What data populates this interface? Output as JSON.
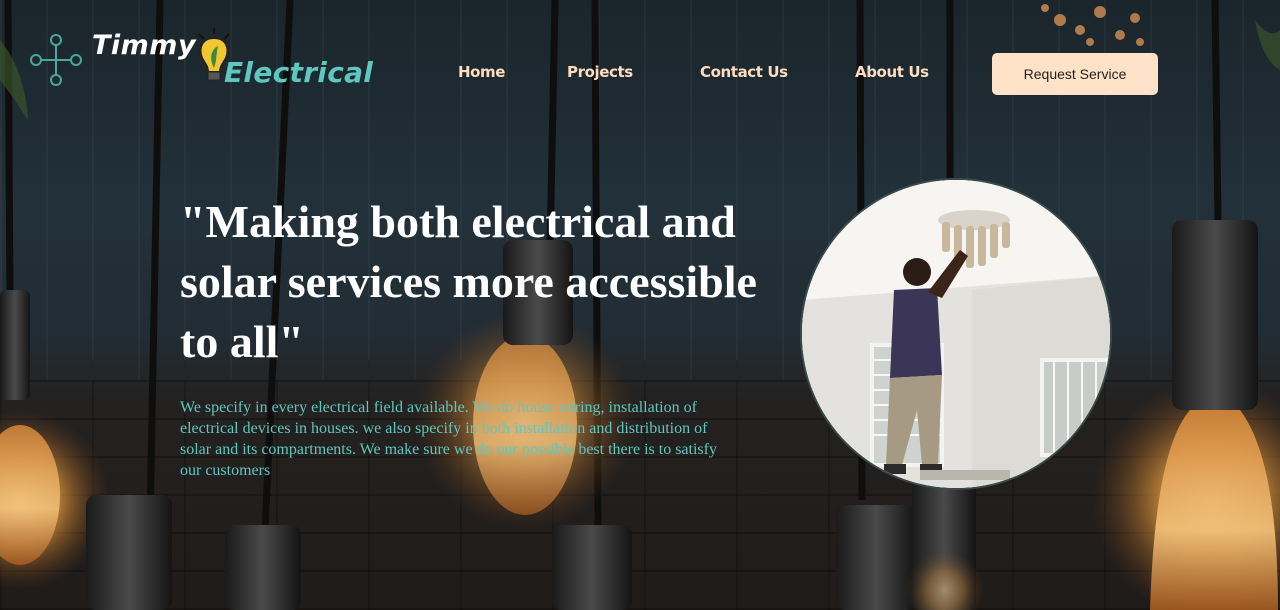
{
  "brand": {
    "name_part1": "Timmy",
    "name_part2": "Electrical",
    "icons": [
      "circuit-logo-icon",
      "lightbulb-icon"
    ]
  },
  "nav": {
    "items": [
      {
        "label": "Home"
      },
      {
        "label": "Projects"
      },
      {
        "label": "Contact Us"
      },
      {
        "label": "About Us"
      }
    ],
    "cta_label": "Request Service"
  },
  "hero": {
    "title": "\"Making both electrical and solar services more accessible to all\"",
    "description": "We specify in every electrical field available. We do house wiring, installation of electrical devices in houses. we also specify in both installation and distribution of solar and its compartments. We make sure we do our possible best there is to satisfy our customers"
  },
  "theme": {
    "accent": "#5fc7c0",
    "nav_text": "#ffdcbf",
    "cta_bg": "#ffe2c7",
    "background": "#1f2a31"
  }
}
